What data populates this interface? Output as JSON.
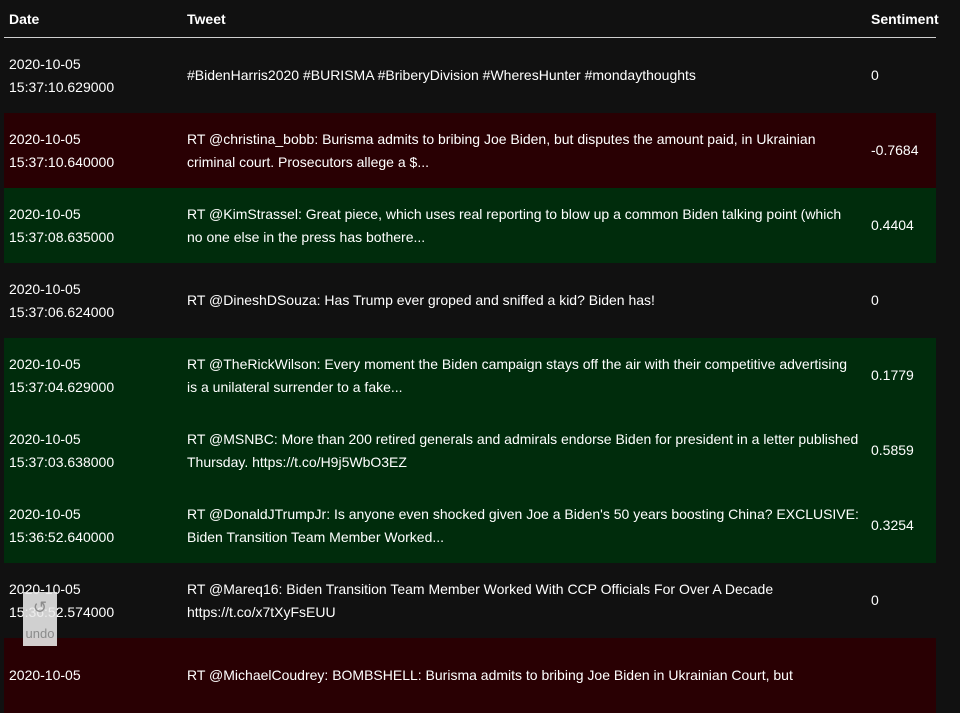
{
  "table": {
    "headers": {
      "date": "Date",
      "tweet": "Tweet",
      "sentiment": "Sentiment"
    },
    "rows": [
      {
        "date": "2020-10-05",
        "time": "15:37:10.629000",
        "tweet": "#BidenHarris2020 #BURISMA #BriberyDivision #WheresHunter #mondaythoughts",
        "sentiment": "0",
        "tone": "neutral"
      },
      {
        "date": "2020-10-05",
        "time": "15:37:10.640000",
        "tweet": "RT @christina_bobb: Burisma admits to bribing Joe Biden, but disputes the amount paid, in Ukrainian criminal court. Prosecutors allege a $...",
        "sentiment": "-0.7684",
        "tone": "negative"
      },
      {
        "date": "2020-10-05",
        "time": "15:37:08.635000",
        "tweet": "RT @KimStrassel: Great piece, which uses real reporting to blow up a common Biden talking point (which no one else in the press has bothere...",
        "sentiment": "0.4404",
        "tone": "positive"
      },
      {
        "date": "2020-10-05",
        "time": "15:37:06.624000",
        "tweet": "RT @DineshDSouza: Has Trump ever groped and sniffed a kid? Biden has!",
        "sentiment": "0",
        "tone": "neutral"
      },
      {
        "date": "2020-10-05",
        "time": "15:37:04.629000",
        "tweet": "RT @TheRickWilson: Every moment the Biden campaign stays off the air with their competitive advertising is a unilateral surrender to a fake...",
        "sentiment": "0.1779",
        "tone": "positive"
      },
      {
        "date": "2020-10-05",
        "time": "15:37:03.638000",
        "tweet": "RT @MSNBC: More than 200 retired generals and admirals endorse Biden for president in a letter published Thursday. https://t.co/H9j5WbO3EZ",
        "sentiment": "0.5859",
        "tone": "positive"
      },
      {
        "date": "2020-10-05",
        "time": "15:36:52.640000",
        "tweet": "RT @DonaldJTrumpJr: Is anyone even shocked given Joe a Biden's 50 years boosting China? EXCLUSIVE: Biden Transition Team Member Worked...",
        "sentiment": "0.3254",
        "tone": "positive"
      },
      {
        "date": "2020-10-05",
        "time": "15:36:52.574000",
        "tweet": "RT @Mareq16: Biden Transition Team Member Worked With CCP Officials For Over A Decade https://t.co/x7tXyFsEUU",
        "sentiment": "0",
        "tone": "neutral"
      },
      {
        "date": "2020-10-05",
        "time": "",
        "tweet": "RT @MichaelCoudrey: BOMBSHELL: Burisma admits to bribing Joe Biden in Ukrainian Court, but",
        "sentiment": "",
        "tone": "negative"
      }
    ]
  },
  "undo": {
    "icon": "undo-icon",
    "label": "undo"
  },
  "colors": {
    "background": "#111111",
    "positive_row": "#002c0c",
    "negative_row": "#290003"
  }
}
